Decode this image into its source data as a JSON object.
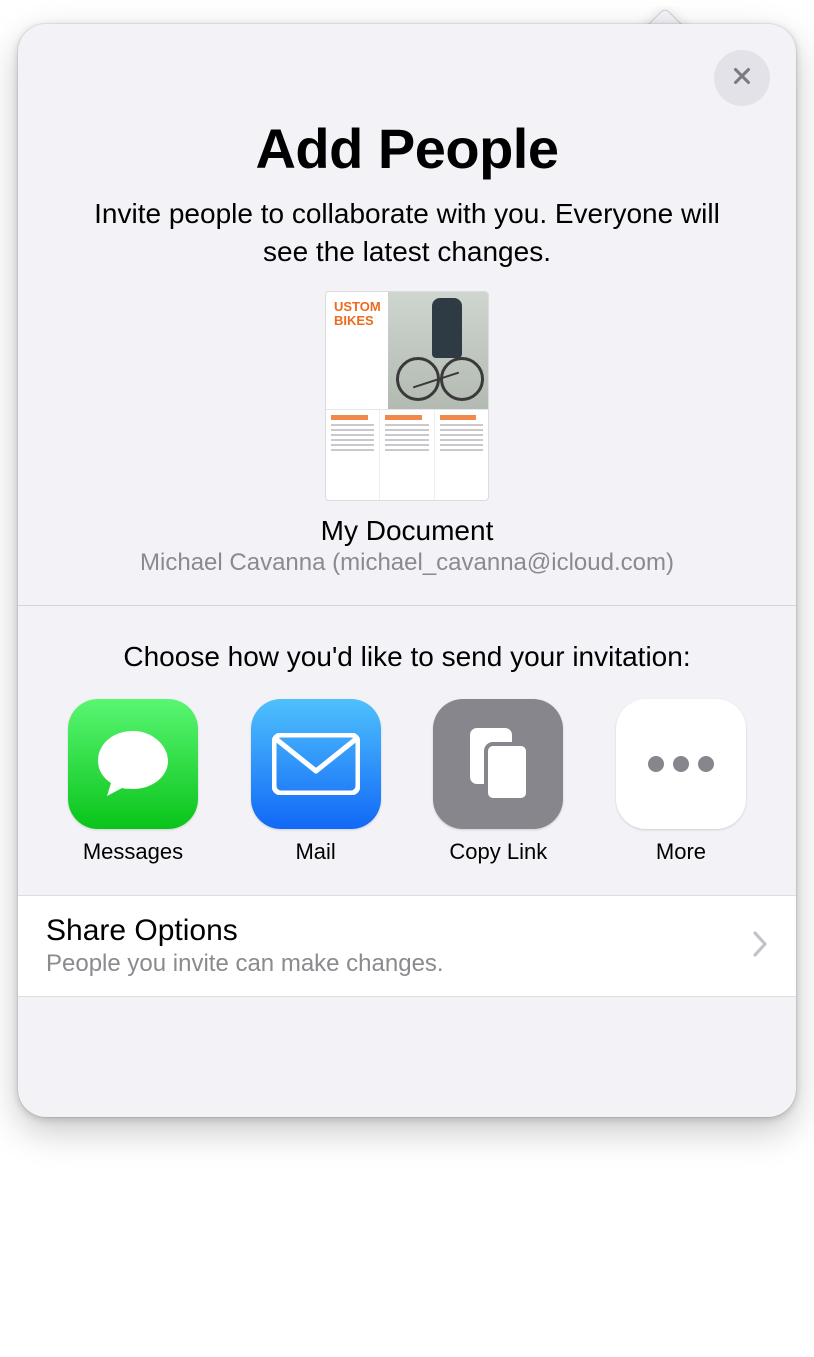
{
  "header": {
    "title": "Add People",
    "subtitle": "Invite people to collaborate with you. Everyone will see the latest changes."
  },
  "document": {
    "thumb_title": "USTOM\nBIKES",
    "name": "My Document",
    "owner": "Michael Cavanna (michael_cavanna@icloud.com)"
  },
  "invite": {
    "prompt": "Choose how you'd like to send your invitation:",
    "apps": [
      {
        "label": "Messages"
      },
      {
        "label": "Mail"
      },
      {
        "label": "Copy Link"
      },
      {
        "label": "More"
      }
    ]
  },
  "share_options": {
    "title": "Share Options",
    "subtitle": "People you invite can make changes."
  }
}
